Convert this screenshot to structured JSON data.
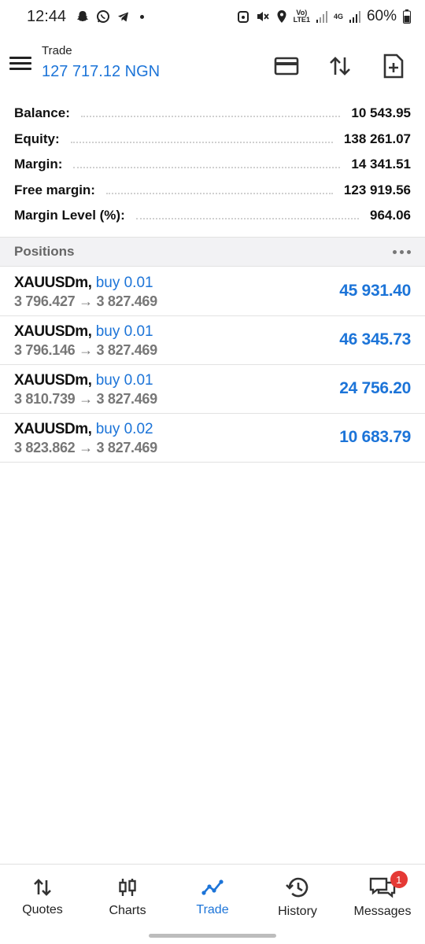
{
  "status_bar": {
    "time": "12:44",
    "network_label_top": "Vo)",
    "network_label_bottom": "LTE1",
    "data_label": "4G",
    "battery": "60%"
  },
  "header": {
    "title": "Trade",
    "value": "127 717.12 NGN"
  },
  "summary": [
    {
      "label": "Balance:",
      "value": "10 543.95"
    },
    {
      "label": "Equity:",
      "value": "138 261.07"
    },
    {
      "label": "Margin:",
      "value": "14 341.51"
    },
    {
      "label": "Free margin:",
      "value": "123 919.56"
    },
    {
      "label": "Margin Level (%):",
      "value": "964.06"
    }
  ],
  "positions": {
    "title": "Positions",
    "items": [
      {
        "symbol": "XAUUSDm,",
        "side": "buy 0.01",
        "prices": "3 796.427 → 3 827.469",
        "profit": "45 931.40"
      },
      {
        "symbol": "XAUUSDm,",
        "side": "buy 0.01",
        "prices": "3 796.146 → 3 827.469",
        "profit": "46 345.73"
      },
      {
        "symbol": "XAUUSDm,",
        "side": "buy 0.01",
        "prices": "3 810.739 → 3 827.469",
        "profit": "24 756.20"
      },
      {
        "symbol": "XAUUSDm,",
        "side": "buy 0.02",
        "prices": "3 823.862 → 3 827.469",
        "profit": "10 683.79"
      }
    ]
  },
  "nav": {
    "quotes": "Quotes",
    "charts": "Charts",
    "trade": "Trade",
    "history": "History",
    "messages": "Messages",
    "messages_badge": "1"
  },
  "colors": {
    "accent": "#1c74d8",
    "badge": "#e53935"
  }
}
